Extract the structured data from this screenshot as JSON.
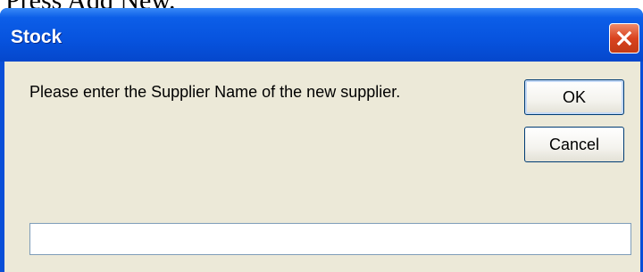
{
  "caption": "Press Add New.",
  "window": {
    "title": "Stock",
    "close_icon": "close-icon",
    "close_color": "#d9431f",
    "titlebar_color": "#0753de"
  },
  "dialog": {
    "prompt": "Please enter the Supplier Name of the new supplier.",
    "ok_label": "OK",
    "cancel_label": "Cancel",
    "input_value": ""
  }
}
